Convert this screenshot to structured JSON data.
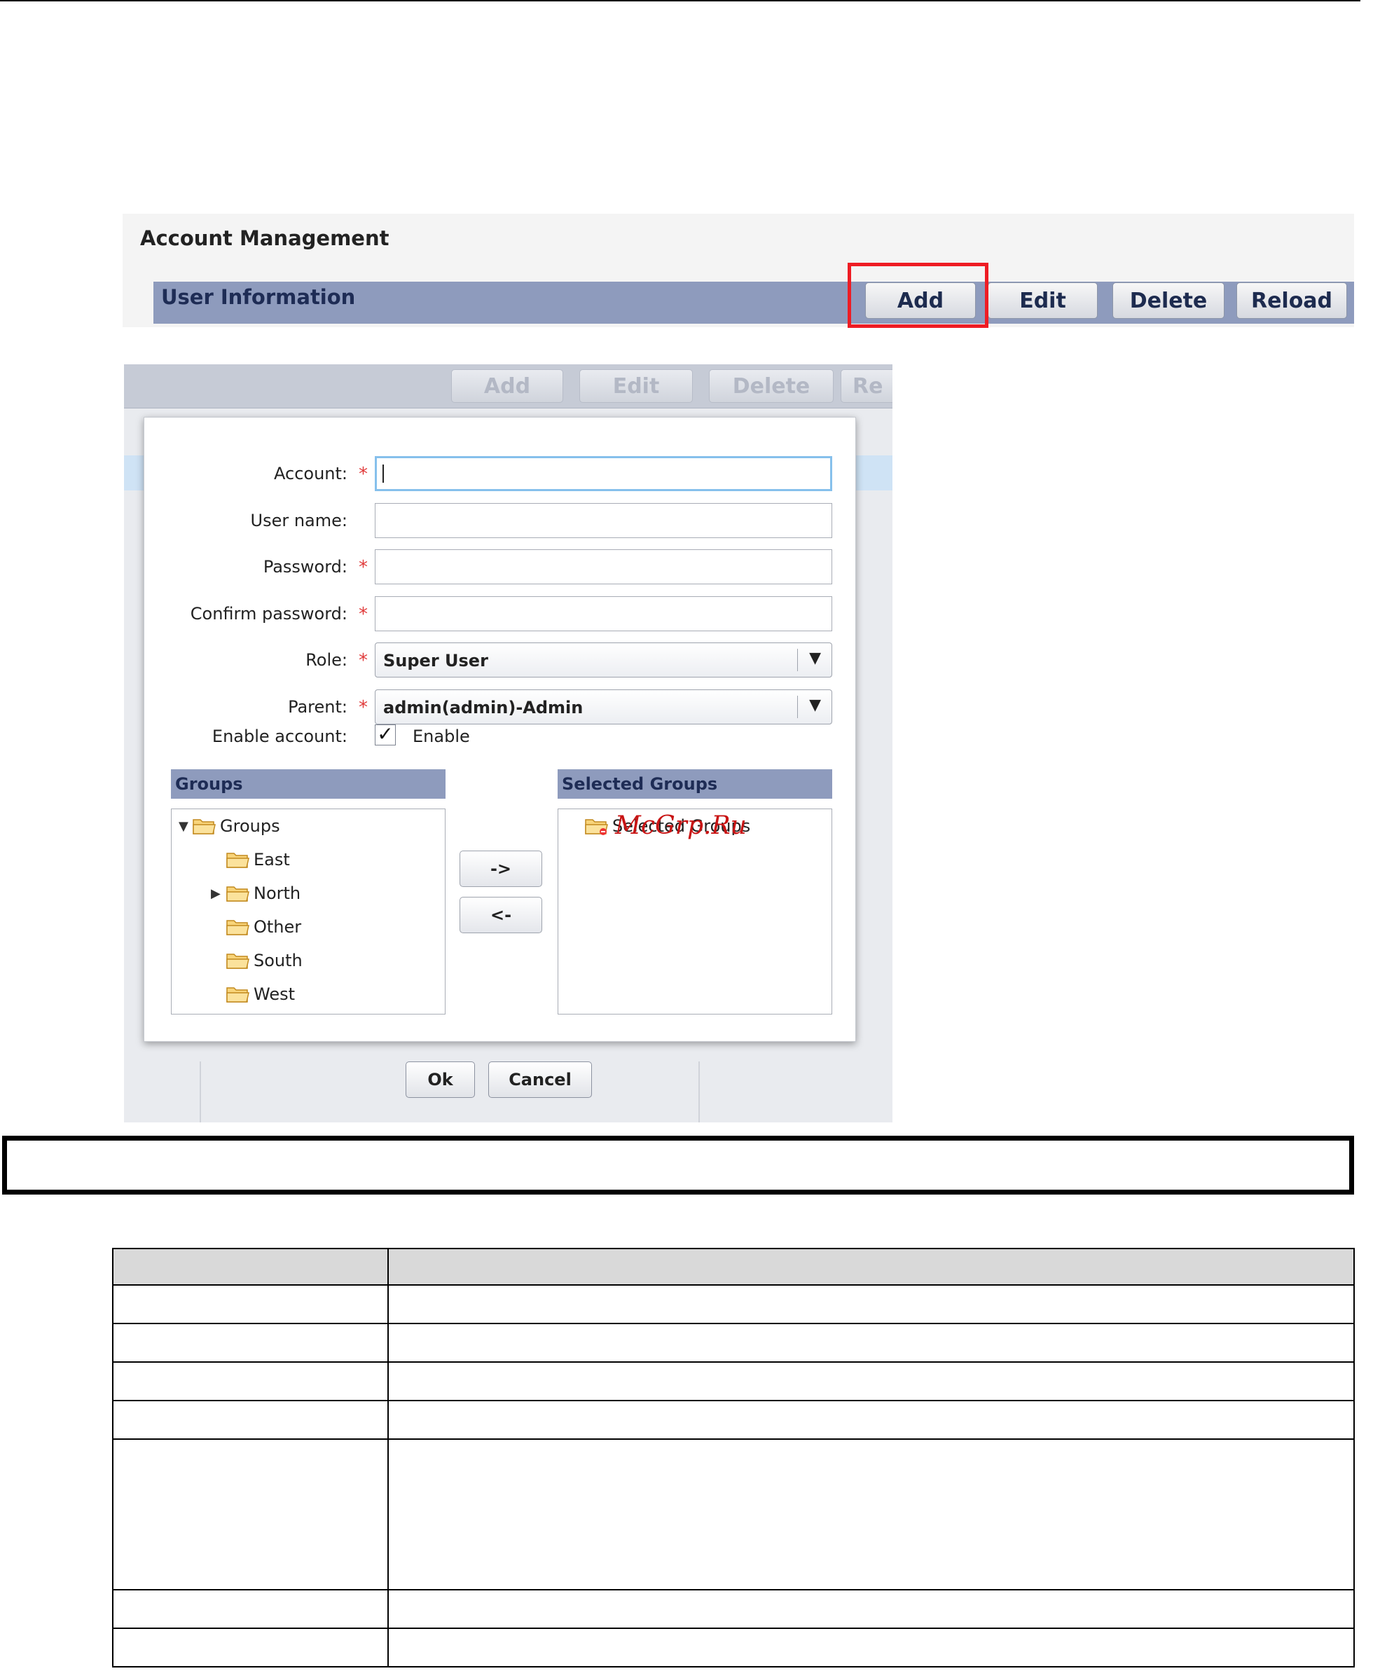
{
  "account_management": {
    "title": "Account Management",
    "section_title": "User Information",
    "toolbar": {
      "add": "Add",
      "edit": "Edit",
      "delete": "Delete",
      "reload": "Reload"
    }
  },
  "dialog_background_toolbar": {
    "add": "Add",
    "edit": "Edit",
    "delete": "Delete",
    "reload_partial": "Re"
  },
  "dialog": {
    "fields": {
      "account_label": "Account:",
      "username_label": "User name:",
      "password_label": "Password:",
      "confirm_label": "Confirm password:",
      "role_label": "Role:",
      "parent_label": "Parent:",
      "enable_label": "Enable account:"
    },
    "required_marker": "*",
    "role_value": "Super User",
    "parent_value": "admin(admin)-Admin",
    "enable_checkbox_label": "Enable",
    "enable_checked": true,
    "checkmark": "✓",
    "groups_header": "Groups",
    "selected_groups_header": "Selected Groups",
    "groups_tree": {
      "root": "Groups",
      "children": [
        "East",
        "North",
        "Other",
        "South",
        "West"
      ]
    },
    "selected_tree_root": "Selected Groups",
    "move_right": "->",
    "move_left": "<-",
    "ok": "Ok",
    "cancel": "Cancel",
    "dropdown_arrow": "▼",
    "expanded_marker": "▼",
    "collapsed_marker": "▶"
  },
  "watermark": "McGrp.Ru",
  "colors": {
    "highlight": "#ee1c24",
    "header_bar": "#8e9bbd",
    "header_text": "#1e2c55",
    "focus_border": "#86c0ec",
    "required": "#e03a3a"
  },
  "icons": [
    "folder-icon",
    "checkbox-icon",
    "dropdown-arrow-icon"
  ]
}
